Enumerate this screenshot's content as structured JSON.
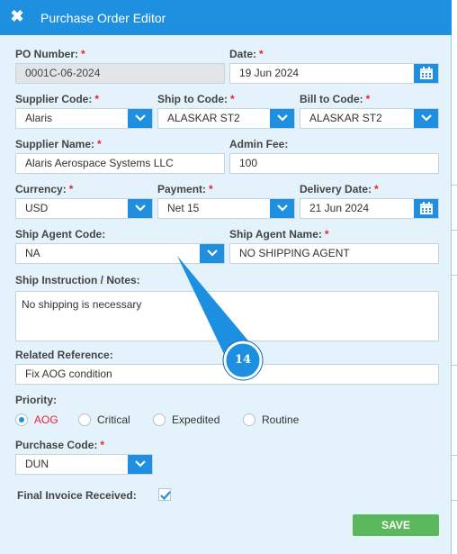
{
  "window": {
    "title": "Purchase Order Editor",
    "close_icon": "close-icon",
    "accent": "#1f8fdf"
  },
  "form": {
    "po_number": {
      "label": "PO Number:",
      "required": "*",
      "value": "0001C-06-2024"
    },
    "date": {
      "label": "Date:",
      "required": "*",
      "value": "19 Jun 2024"
    },
    "supplier_code": {
      "label": "Supplier Code:",
      "required": "*",
      "value": "Alaris"
    },
    "ship_to_code": {
      "label": "Ship to Code:",
      "required": "*",
      "value": "ALASKAR ST2"
    },
    "bill_to_code": {
      "label": "Bill to Code:",
      "required": "*",
      "value": "ALASKAR ST2"
    },
    "supplier_name": {
      "label": "Supplier Name:",
      "required": "*",
      "value": "Alaris Aerospace Systems LLC"
    },
    "admin_fee": {
      "label": "Admin Fee:",
      "value": "100"
    },
    "currency": {
      "label": "Currency:",
      "required": "*",
      "value": "USD"
    },
    "payment": {
      "label": "Payment:",
      "required": "*",
      "value": "Net 15"
    },
    "delivery_date": {
      "label": "Delivery Date:",
      "required": "*",
      "value": "21 Jun 2024"
    },
    "ship_agent_code": {
      "label": "Ship Agent Code:",
      "value": "NA"
    },
    "ship_agent_name": {
      "label": "Ship Agent Name:",
      "required": "*",
      "value": "NO SHIPPING AGENT"
    },
    "ship_instruction": {
      "label": "Ship Instruction / Notes:",
      "value": "No shipping is necessary"
    },
    "related_reference": {
      "label": "Related Reference:",
      "value": "Fix AOG condition"
    },
    "priority": {
      "label": "Priority:",
      "options": [
        "AOG",
        "Critical",
        "Expedited",
        "Routine"
      ],
      "selected": "AOG"
    },
    "purchase_code": {
      "label": "Purchase Code:",
      "required": "*",
      "value": "DUN"
    },
    "final_invoice": {
      "label": "Final Invoice Received:",
      "checked": true
    }
  },
  "actions": {
    "save_label": "SAVE",
    "save_color": "#5cb85c"
  },
  "annotation": {
    "step_number": "14"
  }
}
